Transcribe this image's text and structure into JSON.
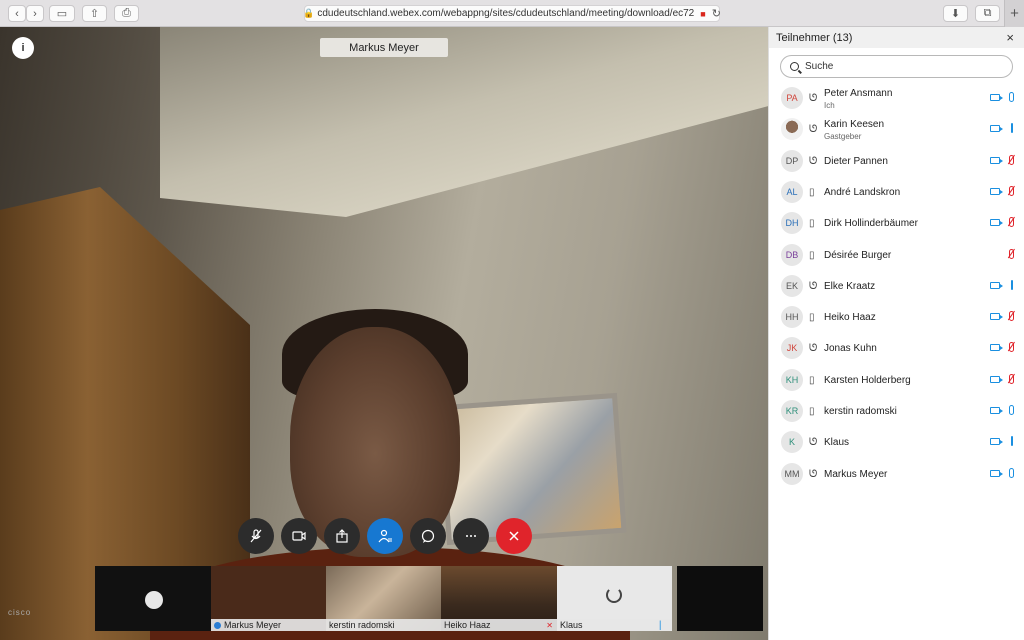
{
  "browser": {
    "url": "cdudeutschland.webex.com/webappng/sites/cdudeutschland/meeting/download/ec72",
    "back_icon": "chevron-left-icon",
    "forward_icon": "chevron-right-icon"
  },
  "meeting": {
    "active_speaker": "Markus Meyer",
    "watermark": "cisco"
  },
  "thumbnails": [
    {
      "name": ""
    },
    {
      "name": "Markus Meyer"
    },
    {
      "name": "kerstin radomski"
    },
    {
      "name": "Heiko Haaz"
    },
    {
      "name": "Klaus"
    },
    {
      "name": ""
    }
  ],
  "panel": {
    "title": "Teilnehmer (13)",
    "close": "×",
    "search_placeholder": "Suche"
  },
  "participants": [
    {
      "initials": "PA",
      "name": "Peter Ansmann",
      "sub": "Ich",
      "device": "headset",
      "video": true,
      "mic": "on",
      "color": "#d0453b"
    },
    {
      "initials": "",
      "name": "Karin Keesen",
      "sub": "Gastgeber",
      "device": "headset",
      "video": true,
      "mic": "level",
      "color": "#555"
    },
    {
      "initials": "DP",
      "name": "Dieter Pannen",
      "sub": "",
      "device": "headset",
      "video": true,
      "mic": "muted",
      "color": "#555"
    },
    {
      "initials": "AL",
      "name": "André Landskron",
      "sub": "",
      "device": "phone",
      "video": true,
      "mic": "muted",
      "color": "#2a6fb8"
    },
    {
      "initials": "DH",
      "name": "Dirk Hollinderbäumer",
      "sub": "",
      "device": "phone",
      "video": true,
      "mic": "muted",
      "color": "#2a6fb8"
    },
    {
      "initials": "DB",
      "name": "Désirée Burger",
      "sub": "",
      "device": "phone",
      "video": false,
      "mic": "muted",
      "color": "#7a3f9a"
    },
    {
      "initials": "EK",
      "name": "Elke Kraatz",
      "sub": "",
      "device": "headset",
      "video": true,
      "mic": "level",
      "color": "#555"
    },
    {
      "initials": "HH",
      "name": "Heiko Haaz",
      "sub": "",
      "device": "phone",
      "video": true,
      "mic": "muted",
      "color": "#555"
    },
    {
      "initials": "JK",
      "name": "Jonas Kuhn",
      "sub": "",
      "device": "headset",
      "video": true,
      "mic": "muted",
      "color": "#d0453b"
    },
    {
      "initials": "KH",
      "name": "Karsten Holderberg",
      "sub": "",
      "device": "phone",
      "video": true,
      "mic": "muted",
      "color": "#2f8f7a"
    },
    {
      "initials": "KR",
      "name": "kerstin radomski",
      "sub": "",
      "device": "phone",
      "video": true,
      "mic": "on",
      "color": "#2f8f7a"
    },
    {
      "initials": "K",
      "name": "Klaus",
      "sub": "",
      "device": "headset",
      "video": true,
      "mic": "level",
      "color": "#2f8f7a"
    },
    {
      "initials": "MM",
      "name": "Markus Meyer",
      "sub": "",
      "device": "headset",
      "video": true,
      "mic": "on",
      "color": "#555"
    }
  ]
}
